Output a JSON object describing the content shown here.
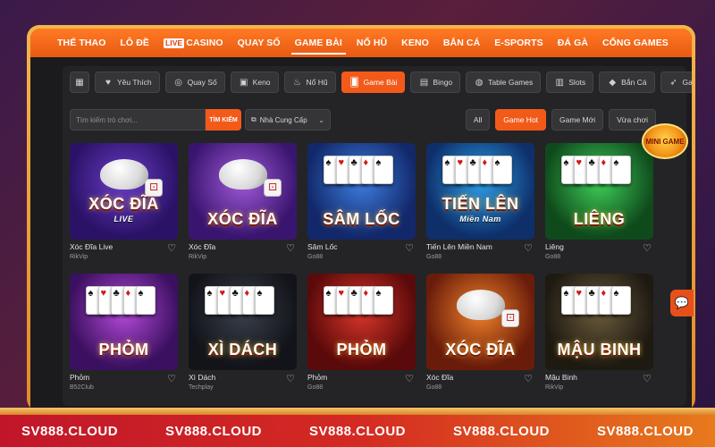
{
  "nav": {
    "items": [
      {
        "label": "THỂ THAO"
      },
      {
        "label": "LÔ ĐỀ"
      },
      {
        "label": "CASINO",
        "tag": "LIVE"
      },
      {
        "label": "QUAY SỐ"
      },
      {
        "label": "GAME BÀI",
        "active": true
      },
      {
        "label": "NỔ HŨ"
      },
      {
        "label": "KENO"
      },
      {
        "label": "BẮN CÁ"
      },
      {
        "label": "E-SPORTS"
      },
      {
        "label": "ĐÁ GÀ"
      },
      {
        "label": "CỔNG GAMES"
      }
    ]
  },
  "categories": [
    {
      "label": "",
      "icon": "grid-icon",
      "glyph": "▦"
    },
    {
      "label": "Yêu Thích",
      "icon": "heart-icon",
      "glyph": "♥"
    },
    {
      "label": "Quay Số",
      "icon": "lottery-icon",
      "glyph": "◎"
    },
    {
      "label": "Keno",
      "icon": "keno-icon",
      "glyph": "▣"
    },
    {
      "label": "Nổ Hũ",
      "icon": "jar-icon",
      "glyph": "♨"
    },
    {
      "label": "Game Bài",
      "icon": "cards-icon",
      "glyph": "🂠",
      "active": true
    },
    {
      "label": "Bingo",
      "icon": "bingo-icon",
      "glyph": "▤"
    },
    {
      "label": "Table Games",
      "icon": "table-icon",
      "glyph": "◍"
    },
    {
      "label": "Slots",
      "icon": "slots-icon",
      "glyph": "▥"
    },
    {
      "label": "Bắn Cá",
      "icon": "fish-icon",
      "glyph": "◆"
    },
    {
      "label": "Games Nhanh",
      "icon": "rocket-icon",
      "glyph": "➶"
    }
  ],
  "search": {
    "placeholder": "Tìm kiếm trò chơi...",
    "button": "TÌM KIẾM",
    "provider_label": "Nhà Cung Cấp"
  },
  "filters": [
    {
      "label": "All"
    },
    {
      "label": "Game Hot",
      "active": true
    },
    {
      "label": "Game Mới"
    },
    {
      "label": "Vừa chơi"
    }
  ],
  "games": [
    {
      "name": "Xóc Đĩa Live",
      "provider": "RikVip",
      "art": "XÓC ĐĨA",
      "sub": "LIVE",
      "style": "xoc1"
    },
    {
      "name": "Xóc Đĩa",
      "provider": "RikVip",
      "art": "XÓC ĐĨA",
      "sub": "",
      "style": "xoc2"
    },
    {
      "name": "Sâm Lốc",
      "provider": "Go88",
      "art": "SÂM LỐC",
      "sub": "",
      "style": "sam"
    },
    {
      "name": "Tiến Lên Miền Nam",
      "provider": "Go88",
      "art": "TIẾN LÊN",
      "sub": "Miền Nam",
      "style": "tien"
    },
    {
      "name": "Liêng",
      "provider": "Go88",
      "art": "LIÊNG",
      "sub": "",
      "style": "lieng"
    },
    {
      "name": "Phỏm",
      "provider": "B52Club",
      "art": "PHỎM",
      "sub": "",
      "style": "phom1"
    },
    {
      "name": "Xì Dách",
      "provider": "Techplay",
      "art": "XÌ DÁCH",
      "sub": "",
      "style": "xi"
    },
    {
      "name": "Phỏm",
      "provider": "Go88",
      "art": "PHỎM",
      "sub": "",
      "style": "phom2"
    },
    {
      "name": "Xóc Đĩa",
      "provider": "Go88",
      "art": "XÓC ĐĨA",
      "sub": "",
      "style": "xoc3"
    },
    {
      "name": "Mậu Binh",
      "provider": "RikVip",
      "art": "MẬU BINH",
      "sub": "",
      "style": "mau"
    }
  ],
  "hot_badge": "MINI GAME",
  "banner": [
    "SV888.CLOUD",
    "SV888.CLOUD",
    "SV888.CLOUD",
    "SV888.CLOUD",
    "SV888.CLOUD"
  ],
  "colors": {
    "accent": "#f25a1a",
    "nav": "#ff7a24",
    "panel": "#242426",
    "frame": "#f3b54a"
  }
}
